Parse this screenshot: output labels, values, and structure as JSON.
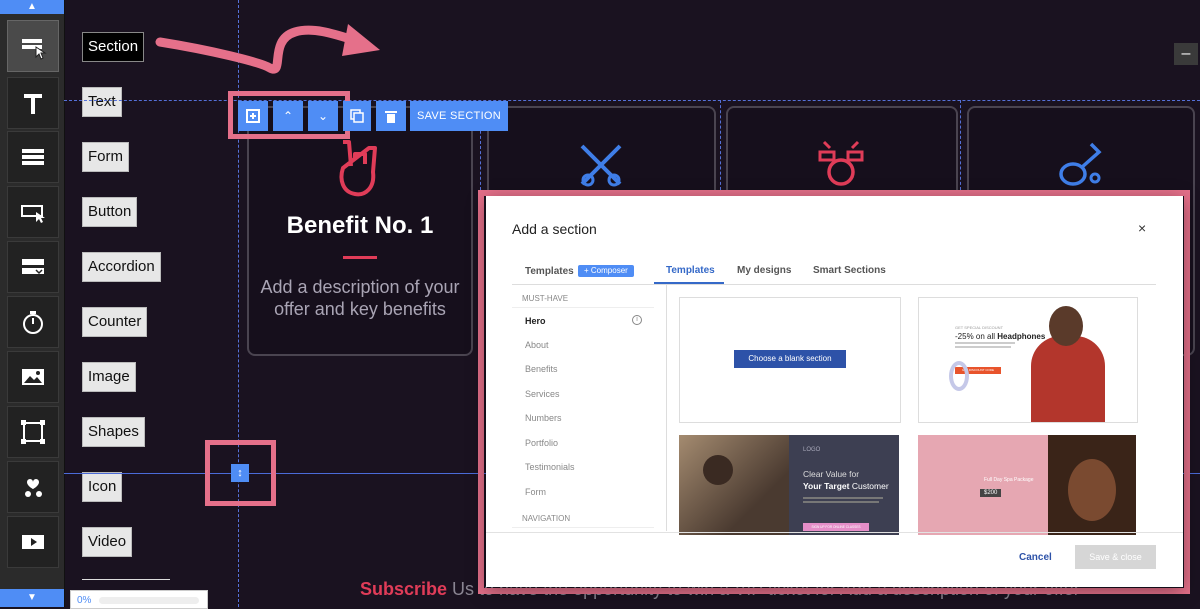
{
  "sidebar": {
    "tools": [
      {
        "name": "section",
        "label": "Section"
      },
      {
        "name": "text",
        "label": "Text"
      },
      {
        "name": "form",
        "label": "Form"
      },
      {
        "name": "button",
        "label": "Button"
      },
      {
        "name": "accordion",
        "label": "Accordion"
      },
      {
        "name": "counter",
        "label": "Counter"
      },
      {
        "name": "image",
        "label": "Image"
      },
      {
        "name": "shapes",
        "label": "Shapes"
      },
      {
        "name": "icon",
        "label": "Icon"
      },
      {
        "name": "video",
        "label": "Video"
      }
    ]
  },
  "toolbar": {
    "save_label": "SAVE SECTION"
  },
  "canvas": {
    "benefit_title": "Benefit No. 1",
    "benefit_desc": "Add a description of your offer and key benefits",
    "subscribe_bold": "Subscribe",
    "subscribe_rest": " Us to have the opportunity to win a VIP ticket for Add a description of your offer",
    "progress": "0%",
    "collapse_label": "–"
  },
  "modal": {
    "title": "Add a section",
    "close": "×",
    "tab_templates_left": "Templates",
    "composer_badge": "Composer",
    "tabs": [
      "Templates",
      "My designs",
      "Smart Sections"
    ],
    "group_musthave": "MUST-HAVE",
    "nav_items": [
      "Hero",
      "About",
      "Benefits",
      "Services",
      "Numbers",
      "Portfolio",
      "Testimonials",
      "Form"
    ],
    "group_navigation": "NAVIGATION",
    "blank_button": "Choose a blank section",
    "cancel": "Cancel",
    "save_close": "Save & close",
    "template2": {
      "tag": "GET SPECIAL DISCOUNT",
      "headline": "-25% on all",
      "headline_bold": "Headphones",
      "cta": "GET DISCOUNT CODE"
    },
    "template3": {
      "logo": "LOGO",
      "line1": "Clear Value for",
      "line2": "Your Target",
      "line2b": "Customer",
      "cta": "SIGN UP FOR ONLINE CLASSES"
    },
    "template4": {
      "line1": "Full Day Spa Package",
      "price": "$200"
    }
  },
  "colors": {
    "accent": "#4f8df5",
    "highlight": "#e5708a",
    "card_icon": "#e03c58",
    "icon_blue": "#3f7ee8"
  }
}
